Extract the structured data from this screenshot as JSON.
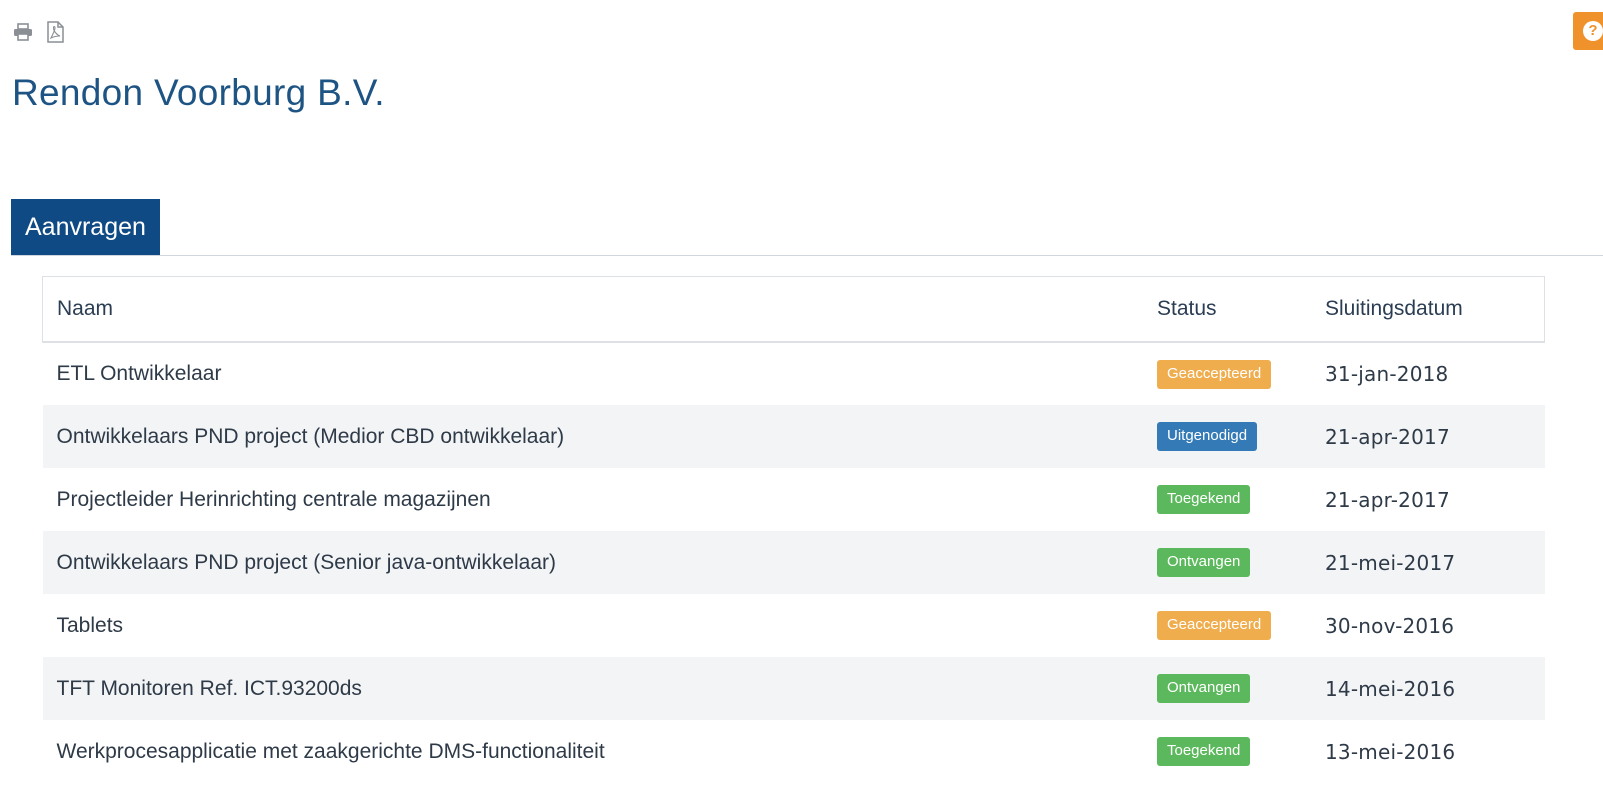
{
  "toolbar": {
    "print_icon": "print-icon",
    "pdf_icon": "pdf-icon"
  },
  "help": {
    "icon": "help-icon",
    "glyph": "?"
  },
  "company": {
    "name": "Rendon Voorburg B.V."
  },
  "tabs": [
    {
      "label": "Aanvragen",
      "active": true
    }
  ],
  "table": {
    "headers": {
      "name": "Naam",
      "status": "Status",
      "closing_date": "Sluitingsdatum"
    },
    "rows": [
      {
        "name": "ETL Ontwikkelaar",
        "status": "Geaccepteerd",
        "status_color": "#f0ad4e",
        "date": "31-jan-2018"
      },
      {
        "name": "Ontwikkelaars PND project (Medior CBD ontwikkelaar)",
        "status": "Uitgenodigd",
        "status_color": "#337ab7",
        "date": "21-apr-2017"
      },
      {
        "name": "Projectleider Herinrichting centrale magazijnen",
        "status": "Toegekend",
        "status_color": "#5cb85c",
        "date": "21-apr-2017"
      },
      {
        "name": "Ontwikkelaars PND project (Senior java-ontwikkelaar)",
        "status": "Ontvangen",
        "status_color": "#5cb85c",
        "date": "21-mei-2017"
      },
      {
        "name": "Tablets",
        "status": "Geaccepteerd",
        "status_color": "#f0ad4e",
        "date": "30-nov-2016"
      },
      {
        "name": "TFT Monitoren Ref. ICT.93200ds",
        "status": "Ontvangen",
        "status_color": "#5cb85c",
        "date": "14-mei-2016"
      },
      {
        "name": "Werkprocesapplicatie met zaakgerichte DMS-functionaliteit",
        "status": "Toegekend",
        "status_color": "#5cb85c",
        "date": "13-mei-2016"
      }
    ]
  },
  "colors": {
    "title": "#1e5483",
    "tab_active": "#0f4a84",
    "help_badge": "#f0922c"
  }
}
